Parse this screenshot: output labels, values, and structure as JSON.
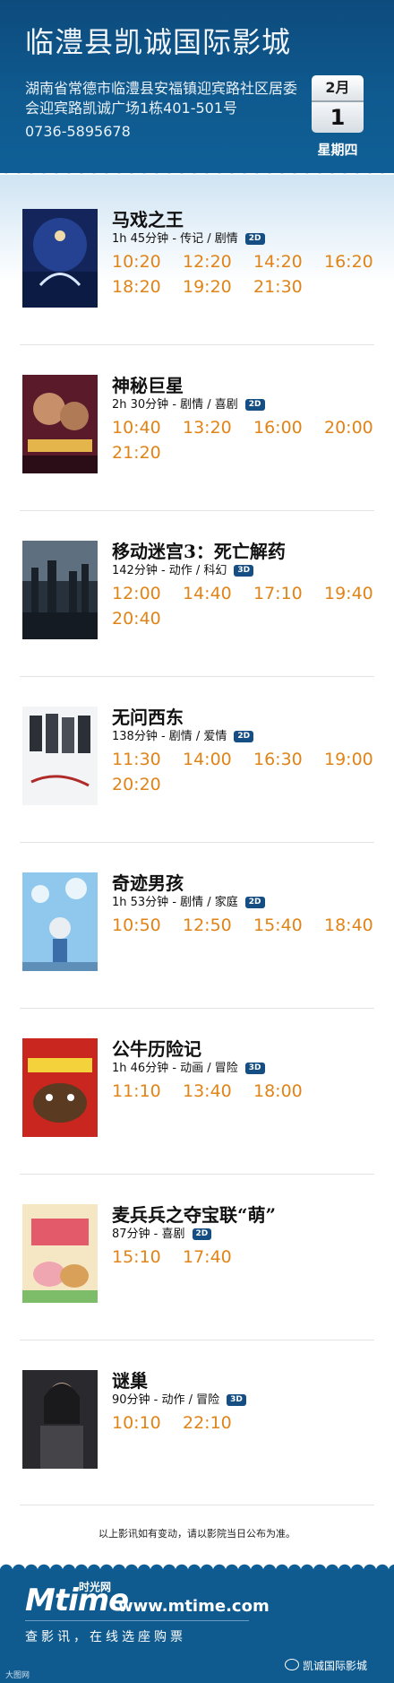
{
  "header": {
    "cinema_name": "临澧县凯诚国际影城",
    "address": "湖南省常德市临澧县安福镇迎宾路社区居委会迎宾路凯诚广场1栋401-501号",
    "phone": "0736-5895678",
    "calendar": {
      "month": "2月",
      "day": "1",
      "weekday": "星期四"
    }
  },
  "movies": [
    {
      "title": "马戏之王",
      "meta": "1h 45分钟 - 传记 / 剧情",
      "format": "2D",
      "times": [
        "10:20",
        "12:20",
        "14:20",
        "16:20",
        "18:20",
        "19:20",
        "21:30"
      ]
    },
    {
      "title": "神秘巨星",
      "meta": "2h 30分钟 - 剧情 / 喜剧",
      "format": "2D",
      "times": [
        "10:40",
        "13:20",
        "16:00",
        "20:00",
        "21:20"
      ]
    },
    {
      "title": "移动迷宫3：死亡解药",
      "meta": "142分钟 - 动作 / 科幻",
      "format": "3D",
      "times": [
        "12:00",
        "14:40",
        "17:10",
        "19:40",
        "20:40"
      ]
    },
    {
      "title": "无问西东",
      "meta": "138分钟 - 剧情 / 爱情",
      "format": "2D",
      "times": [
        "11:30",
        "14:00",
        "16:30",
        "19:00",
        "20:20"
      ]
    },
    {
      "title": "奇迹男孩",
      "meta": "1h 53分钟 - 剧情 / 家庭",
      "format": "2D",
      "times": [
        "10:50",
        "12:50",
        "15:40",
        "18:40"
      ]
    },
    {
      "title": "公牛历险记",
      "meta": "1h 46分钟 - 动画 / 冒险",
      "format": "3D",
      "times": [
        "11:10",
        "13:40",
        "18:00"
      ]
    },
    {
      "title": "麦兵兵之夺宝联“萌”",
      "meta": "87分钟 - 喜剧",
      "format": "2D",
      "times": [
        "15:10",
        "17:40"
      ]
    },
    {
      "title": "谜巢",
      "meta": "90分钟 - 动作 / 冒险",
      "format": "3D",
      "times": [
        "10:10",
        "22:10"
      ]
    }
  ],
  "notice": "以上影讯如有变动，请以影院当日公布为准。",
  "footer": {
    "logo": "Mtime",
    "logo_cn": "时光网",
    "url": "www.mtime.com",
    "slogan": "查影讯，在线选座购票",
    "wechat_account": "凯诚国际影城",
    "watermark": "大图网"
  },
  "colors": {
    "header_blue": "#0f5b8f",
    "showtime_orange": "#e08418",
    "badge_blue": "#154e82"
  }
}
